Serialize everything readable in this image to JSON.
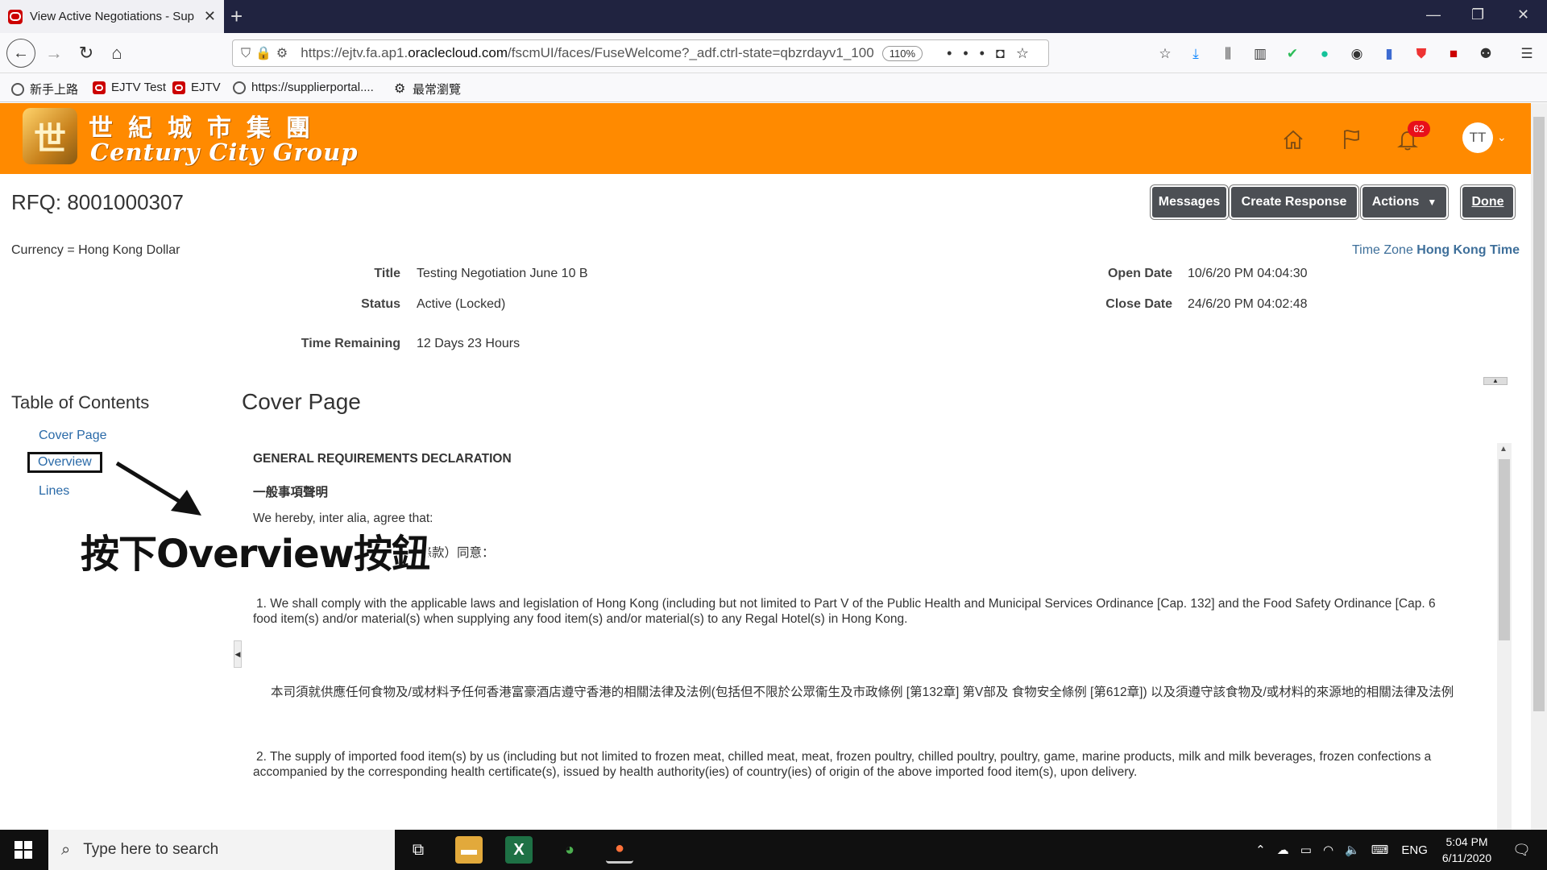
{
  "browser": {
    "tab_title": "View Active Negotiations - Sup",
    "url_prefix": "https://ejtv.fa.ap1.",
    "url_domain": "oraclecloud.com",
    "url_suffix": "/fscmUI/faces/FuseWelcome?_adf.ctrl-state=qbzrdayv1_100",
    "zoom": "110%",
    "bookmarks": [
      "新手上路",
      "EJTV Test",
      "EJTV",
      "https://supplierportal....",
      "最常瀏覽"
    ]
  },
  "header": {
    "logo_zh": "世紀城市集團",
    "logo_en": "Century City Group",
    "notification_count": "62",
    "avatar_initials": "TT"
  },
  "page": {
    "title": "RFQ: 8001000307",
    "buttons": {
      "messages": "Messages",
      "create_response": "Create Response",
      "actions": "Actions",
      "done": "Done"
    },
    "currency": "Currency = Hong Kong Dollar",
    "timezone_label": "Time Zone",
    "timezone_value": "Hong Kong Time",
    "fields": {
      "title_label": "Title",
      "title_value": "Testing Negotiation June 10 B",
      "status_label": "Status",
      "status_value": "Active (Locked)",
      "remaining_label": "Time Remaining",
      "remaining_value": "12 Days 23 Hours",
      "open_label": "Open Date",
      "open_value": "10/6/20 PM 04:04:30",
      "close_label": "Close Date",
      "close_value": "24/6/20 PM 04:02:48"
    }
  },
  "toc": {
    "title": "Table of Contents",
    "items": [
      "Cover Page",
      "Overview",
      "Lines"
    ]
  },
  "cover": {
    "title": "Cover Page",
    "heading_en": "GENERAL REQUIREMENTS DECLARATION",
    "heading_zh": "一般事項聲明",
    "intro": "We hereby, inter alia, agree that:",
    "intro_zh_partial": "之條款）同意：",
    "item1_line1": "1. We shall comply with the applicable laws and legislation of Hong Kong (including but not limited to Part V of the Public Health and Municipal Services Ordinance [Cap. 132] and the Food Safety Ordinance [Cap. 6",
    "item1_line2": "food item(s) and/or material(s) when supplying any food item(s) and/or material(s) to any Regal Hotel(s) in Hong Kong.",
    "item1_zh": "本司須就供應任何食物及/或材料予任何香港富豪酒店遵守香港的相關法律及法例(包括但不限於公眾衞生及市政條例 [第132章] 第V部及 食物安全條例 [第612章]) 以及須遵守該食物及/或材料的來源地的相關法律及法例",
    "item2_line1": "2. The supply of imported food item(s) by us (including but not limited to frozen meat, chilled meat, meat, frozen poultry, chilled poultry, poultry, game, marine products, milk and milk beverages, frozen confections a",
    "item2_line2": "accompanied by the corresponding health certificate(s), issued by health authority(ies) of country(ies) of origin of the above imported food item(s), upon delivery."
  },
  "annotation": {
    "text": "按下Overview按鈕"
  },
  "taskbar": {
    "search_placeholder": "Type here to search",
    "language": "ENG",
    "time": "5:04 PM",
    "date": "6/11/2020"
  },
  "colors": {
    "header_orange": "#ff8a00",
    "button_dark": "#4c4f54",
    "link_blue": "#2a6aa8",
    "badge_red": "#e8101a"
  }
}
